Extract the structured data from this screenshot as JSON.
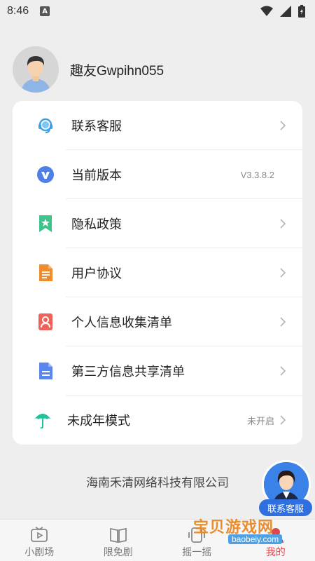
{
  "status_bar": {
    "time": "8:46",
    "notification_letter": "A"
  },
  "profile": {
    "username": "趣友Gwpihn055"
  },
  "menu": [
    {
      "label": "联系客服",
      "value": "",
      "icon": "headset-icon",
      "icon_color": "#3aa0e8"
    },
    {
      "label": "当前版本",
      "value": "V3.3.8.2",
      "icon": "version-v-icon",
      "icon_color": "#4f7fe6"
    },
    {
      "label": "隐私政策",
      "value": "",
      "icon": "bookmark-star-icon",
      "icon_color": "#3cc48b"
    },
    {
      "label": "用户协议",
      "value": "",
      "icon": "document-icon",
      "icon_color": "#f08a2c"
    },
    {
      "label": "个人信息收集清单",
      "value": "",
      "icon": "user-card-icon",
      "icon_color": "#f0615a"
    },
    {
      "label": "第三方信息共享清单",
      "value": "",
      "icon": "list-document-icon",
      "icon_color": "#5a86f0"
    },
    {
      "label": "未成年模式",
      "value": "未开启",
      "icon": "umbrella-icon",
      "icon_color": "#20c29a"
    }
  ],
  "company": "海南禾清网络科技有限公司",
  "float_service": {
    "label": "联系客服"
  },
  "tabs": [
    {
      "label": "小剧场",
      "icon": "tv-play-icon",
      "active": false
    },
    {
      "label": "限免剧",
      "icon": "book-icon",
      "active": false
    },
    {
      "label": "摇一摇",
      "icon": "shake-icon",
      "active": false
    },
    {
      "label": "我的",
      "icon": "profile-icon",
      "active": true
    }
  ],
  "watermark": {
    "text": "宝贝游戏网",
    "url": "baobeiy.com"
  },
  "colors": {
    "accent": "#e0474b",
    "background": "#eeeeee",
    "card": "#ffffff",
    "service_blue": "#2f6fe0"
  }
}
